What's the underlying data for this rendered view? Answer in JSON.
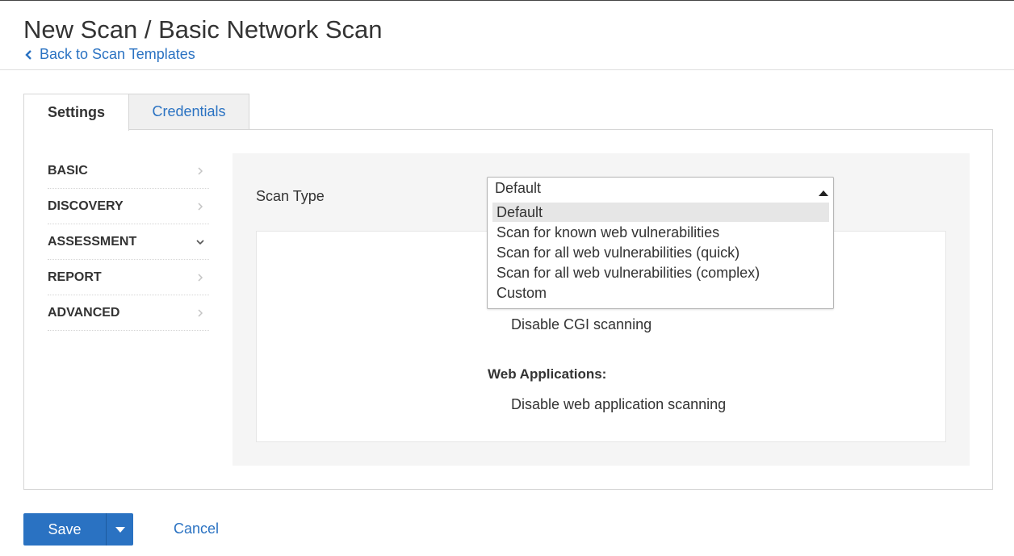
{
  "header": {
    "title": "New Scan / Basic Network Scan",
    "back_link": "Back to Scan Templates"
  },
  "tabs": [
    {
      "label": "Settings",
      "active": true
    },
    {
      "label": "Credentials",
      "active": false
    }
  ],
  "side_nav": {
    "items": [
      {
        "label": "BASIC",
        "expanded": false
      },
      {
        "label": "DISCOVERY",
        "expanded": false
      },
      {
        "label": "ASSESSMENT",
        "expanded": true
      },
      {
        "label": "REPORT",
        "expanded": false
      },
      {
        "label": "ADVANCED",
        "expanded": false
      }
    ]
  },
  "scan_type": {
    "label": "Scan Type",
    "selected": "Default",
    "options": [
      "Default",
      "Scan for known web vulnerabilities",
      "Scan for all web vulnerabilities (quick)",
      "Scan for all web vulnerabilities (complex)",
      "Custom"
    ]
  },
  "settings_details": {
    "cgi_text": "Disable CGI scanning",
    "web_apps_heading": "Web Applications:",
    "web_apps_text": "Disable web application scanning"
  },
  "footer": {
    "save_label": "Save",
    "cancel_label": "Cancel"
  },
  "colors": {
    "accent": "#2a72c2",
    "panel_bg": "#f5f5f5",
    "border": "#d6d6d6"
  }
}
